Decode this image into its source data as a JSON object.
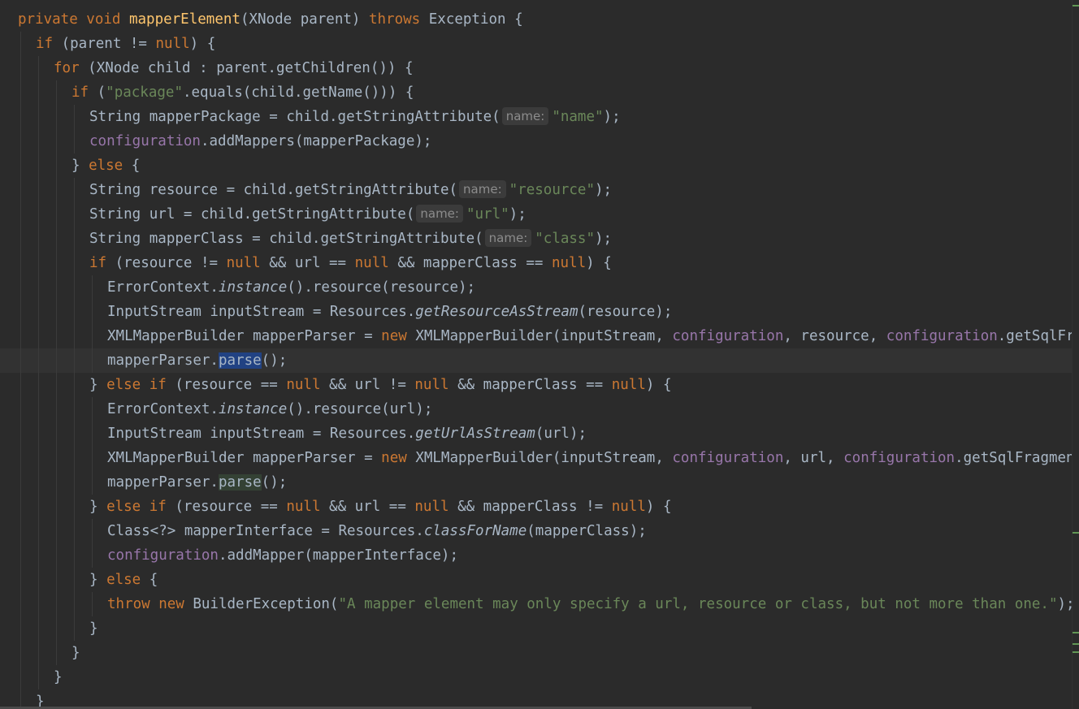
{
  "editor": {
    "lines": [
      {
        "indent": 0,
        "tokens": [
          {
            "t": "private void ",
            "c": "kw"
          },
          {
            "t": "mapperElement",
            "c": "fn"
          },
          {
            "t": "(XNode parent) "
          },
          {
            "t": "throws ",
            "c": "kw"
          },
          {
            "t": "Exception {"
          }
        ]
      },
      {
        "indent": 1,
        "tokens": [
          {
            "t": "if ",
            "c": "kw"
          },
          {
            "t": "(parent != "
          },
          {
            "t": "null",
            "c": "kw"
          },
          {
            "t": ") {"
          }
        ]
      },
      {
        "indent": 2,
        "tokens": [
          {
            "t": "for ",
            "c": "kw"
          },
          {
            "t": "(XNode child : parent.getChildren()) {"
          }
        ]
      },
      {
        "indent": 3,
        "tokens": [
          {
            "t": "if ",
            "c": "kw"
          },
          {
            "t": "("
          },
          {
            "t": "\"package\"",
            "c": "str"
          },
          {
            "t": ".equals(child.getName())) {"
          }
        ]
      },
      {
        "indent": 4,
        "tokens": [
          {
            "t": "String mapperPackage = child.getStringAttribute("
          },
          {
            "t": "name:",
            "c": "hint"
          },
          {
            "t": "\"name\"",
            "c": "str"
          },
          {
            "t": ");"
          }
        ]
      },
      {
        "indent": 4,
        "tokens": [
          {
            "t": "configuration",
            "c": "field"
          },
          {
            "t": ".addMappers(mapperPackage);"
          }
        ]
      },
      {
        "indent": 3,
        "tokens": [
          {
            "t": "} "
          },
          {
            "t": "else ",
            "c": "kw"
          },
          {
            "t": "{"
          }
        ]
      },
      {
        "indent": 4,
        "tokens": [
          {
            "t": "String resource = child.getStringAttribute("
          },
          {
            "t": "name:",
            "c": "hint"
          },
          {
            "t": "\"resource\"",
            "c": "str"
          },
          {
            "t": ");"
          }
        ]
      },
      {
        "indent": 4,
        "tokens": [
          {
            "t": "String url = child.getStringAttribute("
          },
          {
            "t": "name:",
            "c": "hint"
          },
          {
            "t": "\"url\"",
            "c": "str"
          },
          {
            "t": ");"
          }
        ]
      },
      {
        "indent": 4,
        "tokens": [
          {
            "t": "String mapperClass = child.getStringAttribute("
          },
          {
            "t": "name:",
            "c": "hint"
          },
          {
            "t": "\"class\"",
            "c": "str"
          },
          {
            "t": ");"
          }
        ]
      },
      {
        "indent": 4,
        "tokens": [
          {
            "t": "if ",
            "c": "kw"
          },
          {
            "t": "(resource != "
          },
          {
            "t": "null ",
            "c": "kw"
          },
          {
            "t": "&& url == "
          },
          {
            "t": "null ",
            "c": "kw"
          },
          {
            "t": "&& mapperClass == "
          },
          {
            "t": "null",
            "c": "kw"
          },
          {
            "t": ") {"
          }
        ]
      },
      {
        "indent": 5,
        "tokens": [
          {
            "t": "ErrorContext."
          },
          {
            "t": "instance",
            "c": "it"
          },
          {
            "t": "().resource(resource);"
          }
        ]
      },
      {
        "indent": 5,
        "tokens": [
          {
            "t": "InputStream inputStream = Resources."
          },
          {
            "t": "getResourceAsStream",
            "c": "it"
          },
          {
            "t": "(resource);"
          }
        ]
      },
      {
        "indent": 5,
        "tokens": [
          {
            "t": "XMLMapperBuilder mapperParser = "
          },
          {
            "t": "new ",
            "c": "kw"
          },
          {
            "t": "XMLMapperBuilder(inputStream, "
          },
          {
            "t": "configuration",
            "c": "field"
          },
          {
            "t": ", resource, "
          },
          {
            "t": "configuration",
            "c": "field"
          },
          {
            "t": ".getSqlFragments());"
          }
        ]
      },
      {
        "indent": 5,
        "current": true,
        "tokens": [
          {
            "t": "mapperParser."
          },
          {
            "t": "parse",
            "c": "sel"
          },
          {
            "t": "();"
          }
        ]
      },
      {
        "indent": 4,
        "tokens": [
          {
            "t": "} "
          },
          {
            "t": "else if ",
            "c": "kw"
          },
          {
            "t": "(resource == "
          },
          {
            "t": "null ",
            "c": "kw"
          },
          {
            "t": "&& url != "
          },
          {
            "t": "null ",
            "c": "kw"
          },
          {
            "t": "&& mapperClass == "
          },
          {
            "t": "null",
            "c": "kw"
          },
          {
            "t": ") {"
          }
        ]
      },
      {
        "indent": 5,
        "tokens": [
          {
            "t": "ErrorContext."
          },
          {
            "t": "instance",
            "c": "it"
          },
          {
            "t": "().resource(url);"
          }
        ]
      },
      {
        "indent": 5,
        "tokens": [
          {
            "t": "InputStream inputStream = Resources."
          },
          {
            "t": "getUrlAsStream",
            "c": "it"
          },
          {
            "t": "(url);"
          }
        ]
      },
      {
        "indent": 5,
        "tokens": [
          {
            "t": "XMLMapperBuilder mapperParser = "
          },
          {
            "t": "new ",
            "c": "kw"
          },
          {
            "t": "XMLMapperBuilder(inputStream, "
          },
          {
            "t": "configuration",
            "c": "field"
          },
          {
            "t": ", url, "
          },
          {
            "t": "configuration",
            "c": "field"
          },
          {
            "t": ".getSqlFragments());"
          }
        ]
      },
      {
        "indent": 5,
        "tokens": [
          {
            "t": "mapperParser."
          },
          {
            "t": "parse",
            "c": "hl"
          },
          {
            "t": "();"
          }
        ]
      },
      {
        "indent": 4,
        "tokens": [
          {
            "t": "} "
          },
          {
            "t": "else if ",
            "c": "kw"
          },
          {
            "t": "(resource == "
          },
          {
            "t": "null ",
            "c": "kw"
          },
          {
            "t": "&& url == "
          },
          {
            "t": "null ",
            "c": "kw"
          },
          {
            "t": "&& mapperClass != "
          },
          {
            "t": "null",
            "c": "kw"
          },
          {
            "t": ") {"
          }
        ]
      },
      {
        "indent": 5,
        "tokens": [
          {
            "t": "Class<?> mapperInterface = Resources."
          },
          {
            "t": "classForName",
            "c": "it"
          },
          {
            "t": "(mapperClass);"
          }
        ]
      },
      {
        "indent": 5,
        "tokens": [
          {
            "t": "configuration",
            "c": "field"
          },
          {
            "t": ".addMapper(mapperInterface);"
          }
        ]
      },
      {
        "indent": 4,
        "tokens": [
          {
            "t": "} "
          },
          {
            "t": "else ",
            "c": "kw"
          },
          {
            "t": "{"
          }
        ]
      },
      {
        "indent": 5,
        "tokens": [
          {
            "t": "throw new ",
            "c": "kw"
          },
          {
            "t": "BuilderException("
          },
          {
            "t": "\"A mapper element may only specify a url, resource or class, but not more than one.\"",
            "c": "str"
          },
          {
            "t": ");"
          }
        ]
      },
      {
        "indent": 4,
        "tokens": [
          {
            "t": "}"
          }
        ]
      },
      {
        "indent": 3,
        "tokens": [
          {
            "t": "}"
          }
        ]
      },
      {
        "indent": 2,
        "tokens": [
          {
            "t": "}"
          }
        ]
      },
      {
        "indent": 1,
        "tokens": [
          {
            "t": "}"
          }
        ]
      }
    ]
  },
  "theme": {
    "background": "#2b2b2b",
    "keyword": "#cc7832",
    "method_declaration": "#ffc66d",
    "string": "#6a8759",
    "field": "#9876aa",
    "text": "#a9b7c6",
    "selection": "#214283"
  }
}
